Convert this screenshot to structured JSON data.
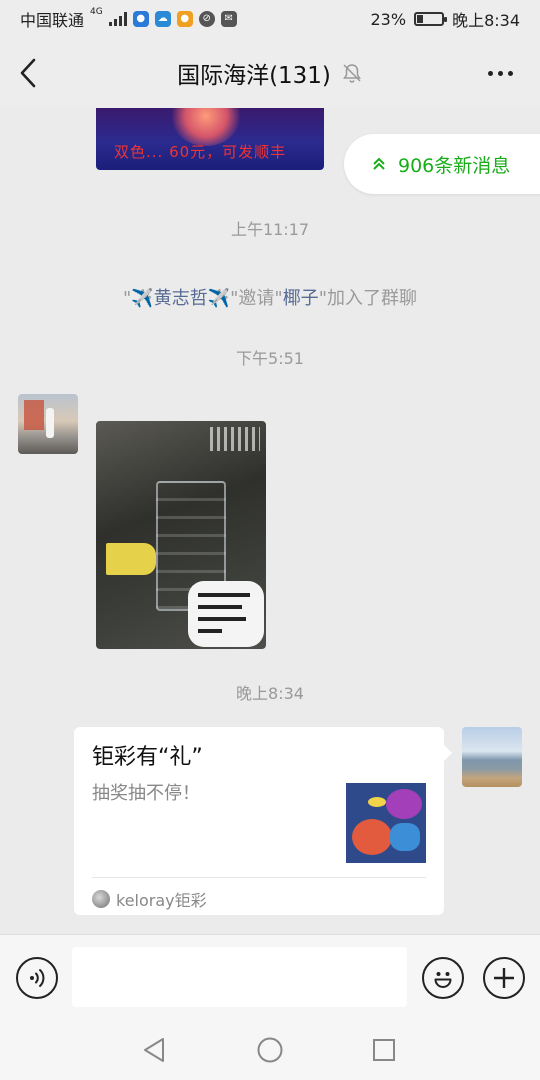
{
  "status_bar": {
    "carrier": "中国联通",
    "network": "4G",
    "battery": "23%",
    "time": "晚上8:34"
  },
  "nav": {
    "title": "国际海洋(131)"
  },
  "chat": {
    "top_image_caption": "双色... 60元，可发顺丰",
    "new_messages_label": "906条新消息",
    "time_1": "上午11:17",
    "system_message": {
      "inviter": "✈️黄志哲✈️",
      "text_1": "\"",
      "text_2": "\"邀请\"",
      "invitee": "椰子",
      "text_3": "\"加入了群聊"
    },
    "time_2": "下午5:51",
    "time_3": "晚上8:34",
    "card": {
      "title": "钜彩有“礼”",
      "description": "抽奖抽不停！",
      "source": "keloray钜彩"
    }
  },
  "input_bar": {
    "message_value": ""
  }
}
